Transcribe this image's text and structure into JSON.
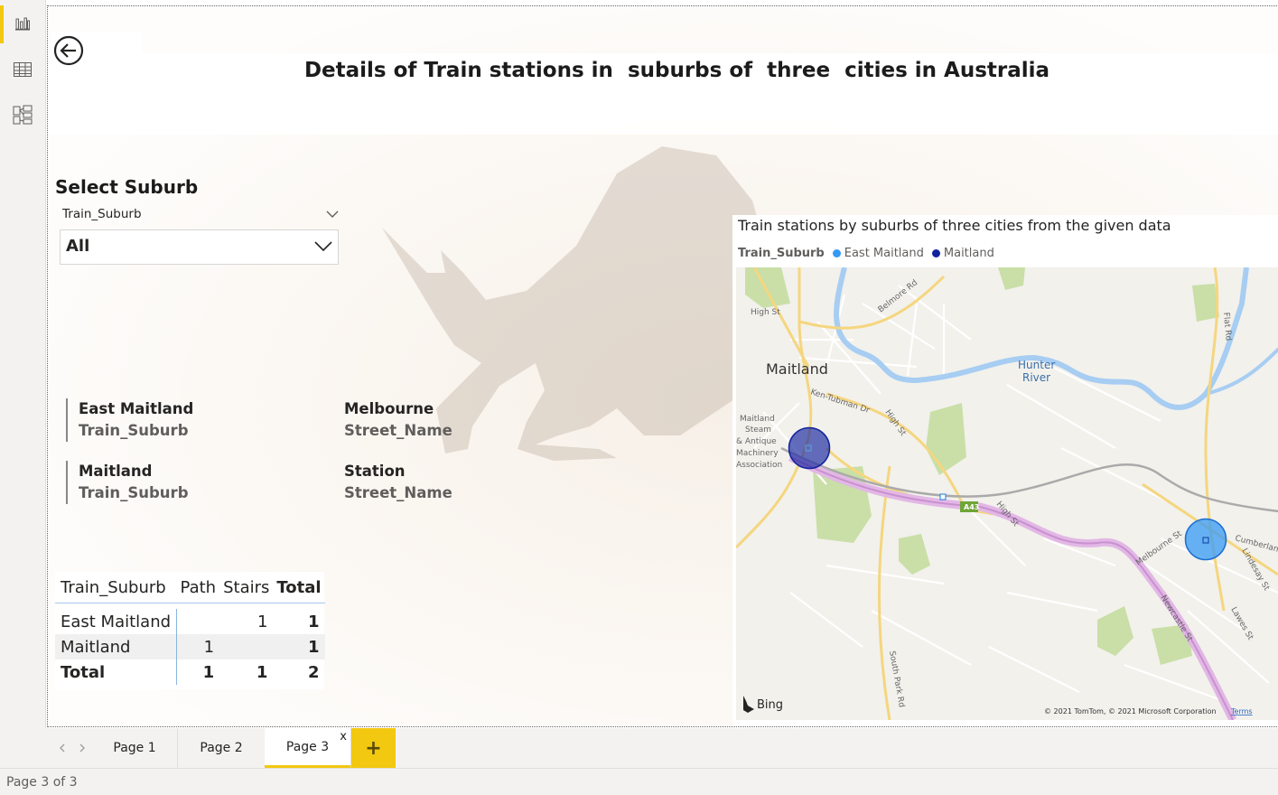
{
  "report": {
    "title": "Details of Train stations in  suburbs of  three  cities in Australia"
  },
  "rail": {
    "icons": [
      "bar-chart-icon",
      "table-grid-icon",
      "model-view-icon"
    ]
  },
  "slicer": {
    "heading": "Select Suburb",
    "field": "Train_Suburb",
    "selected": "All"
  },
  "cards": [
    {
      "value": "East Maitland",
      "label": "Train_Suburb"
    },
    {
      "value": "Maitland",
      "label": "Train_Suburb"
    },
    {
      "value": "Melbourne",
      "label": "Street_Name"
    },
    {
      "value": "Station",
      "label": "Street_Name"
    }
  ],
  "matrix": {
    "headers": [
      "Train_Suburb",
      "Path",
      "Stairs",
      "Total"
    ],
    "rows": [
      [
        "East Maitland",
        "",
        "1",
        "1"
      ],
      [
        "Maitland",
        "1",
        "",
        "1"
      ],
      [
        "Total",
        "1",
        "1",
        "2"
      ]
    ]
  },
  "map_visual": {
    "title": "Train stations by suburbs of three cities from the given data",
    "legend_field": "Train_Suburb",
    "legend": [
      {
        "name": "East Maitland",
        "color": "#3599f6"
      },
      {
        "name": "Maitland",
        "color": "#12239e"
      }
    ],
    "labels": {
      "city": "Maitland",
      "river": "Hunter River",
      "high_st": "High St",
      "belmore": "Belmore Rd",
      "ken_tubman": "Ken-Tubman Dr",
      "high_st2": "High St",
      "museum": "Maitland Steam & Antique Machinery Association",
      "a43": "A43",
      "high_st3": "High St",
      "melbourne_st": "Melbourne St",
      "newcastle_st": "Newcastle St",
      "flat_rd": "Flat Rd",
      "cumberland": "Cumberland",
      "lindesay": "Lindesay St",
      "lawes": "Lawes St",
      "south_park": "South Park Rd",
      "bing": "Bing",
      "copyright": "© 2021 TomTom, © 2021 Microsoft Corporation",
      "terms": "Terms"
    }
  },
  "tabs": [
    {
      "label": "Page 1"
    },
    {
      "label": "Page 2"
    },
    {
      "label": "Page 3"
    }
  ],
  "tab_close": "x",
  "add_page": "+",
  "status": "Page 3 of 3",
  "colors": {
    "accent": "#f2c811",
    "east_maitland": "#3599f6",
    "maitland": "#12239e"
  }
}
